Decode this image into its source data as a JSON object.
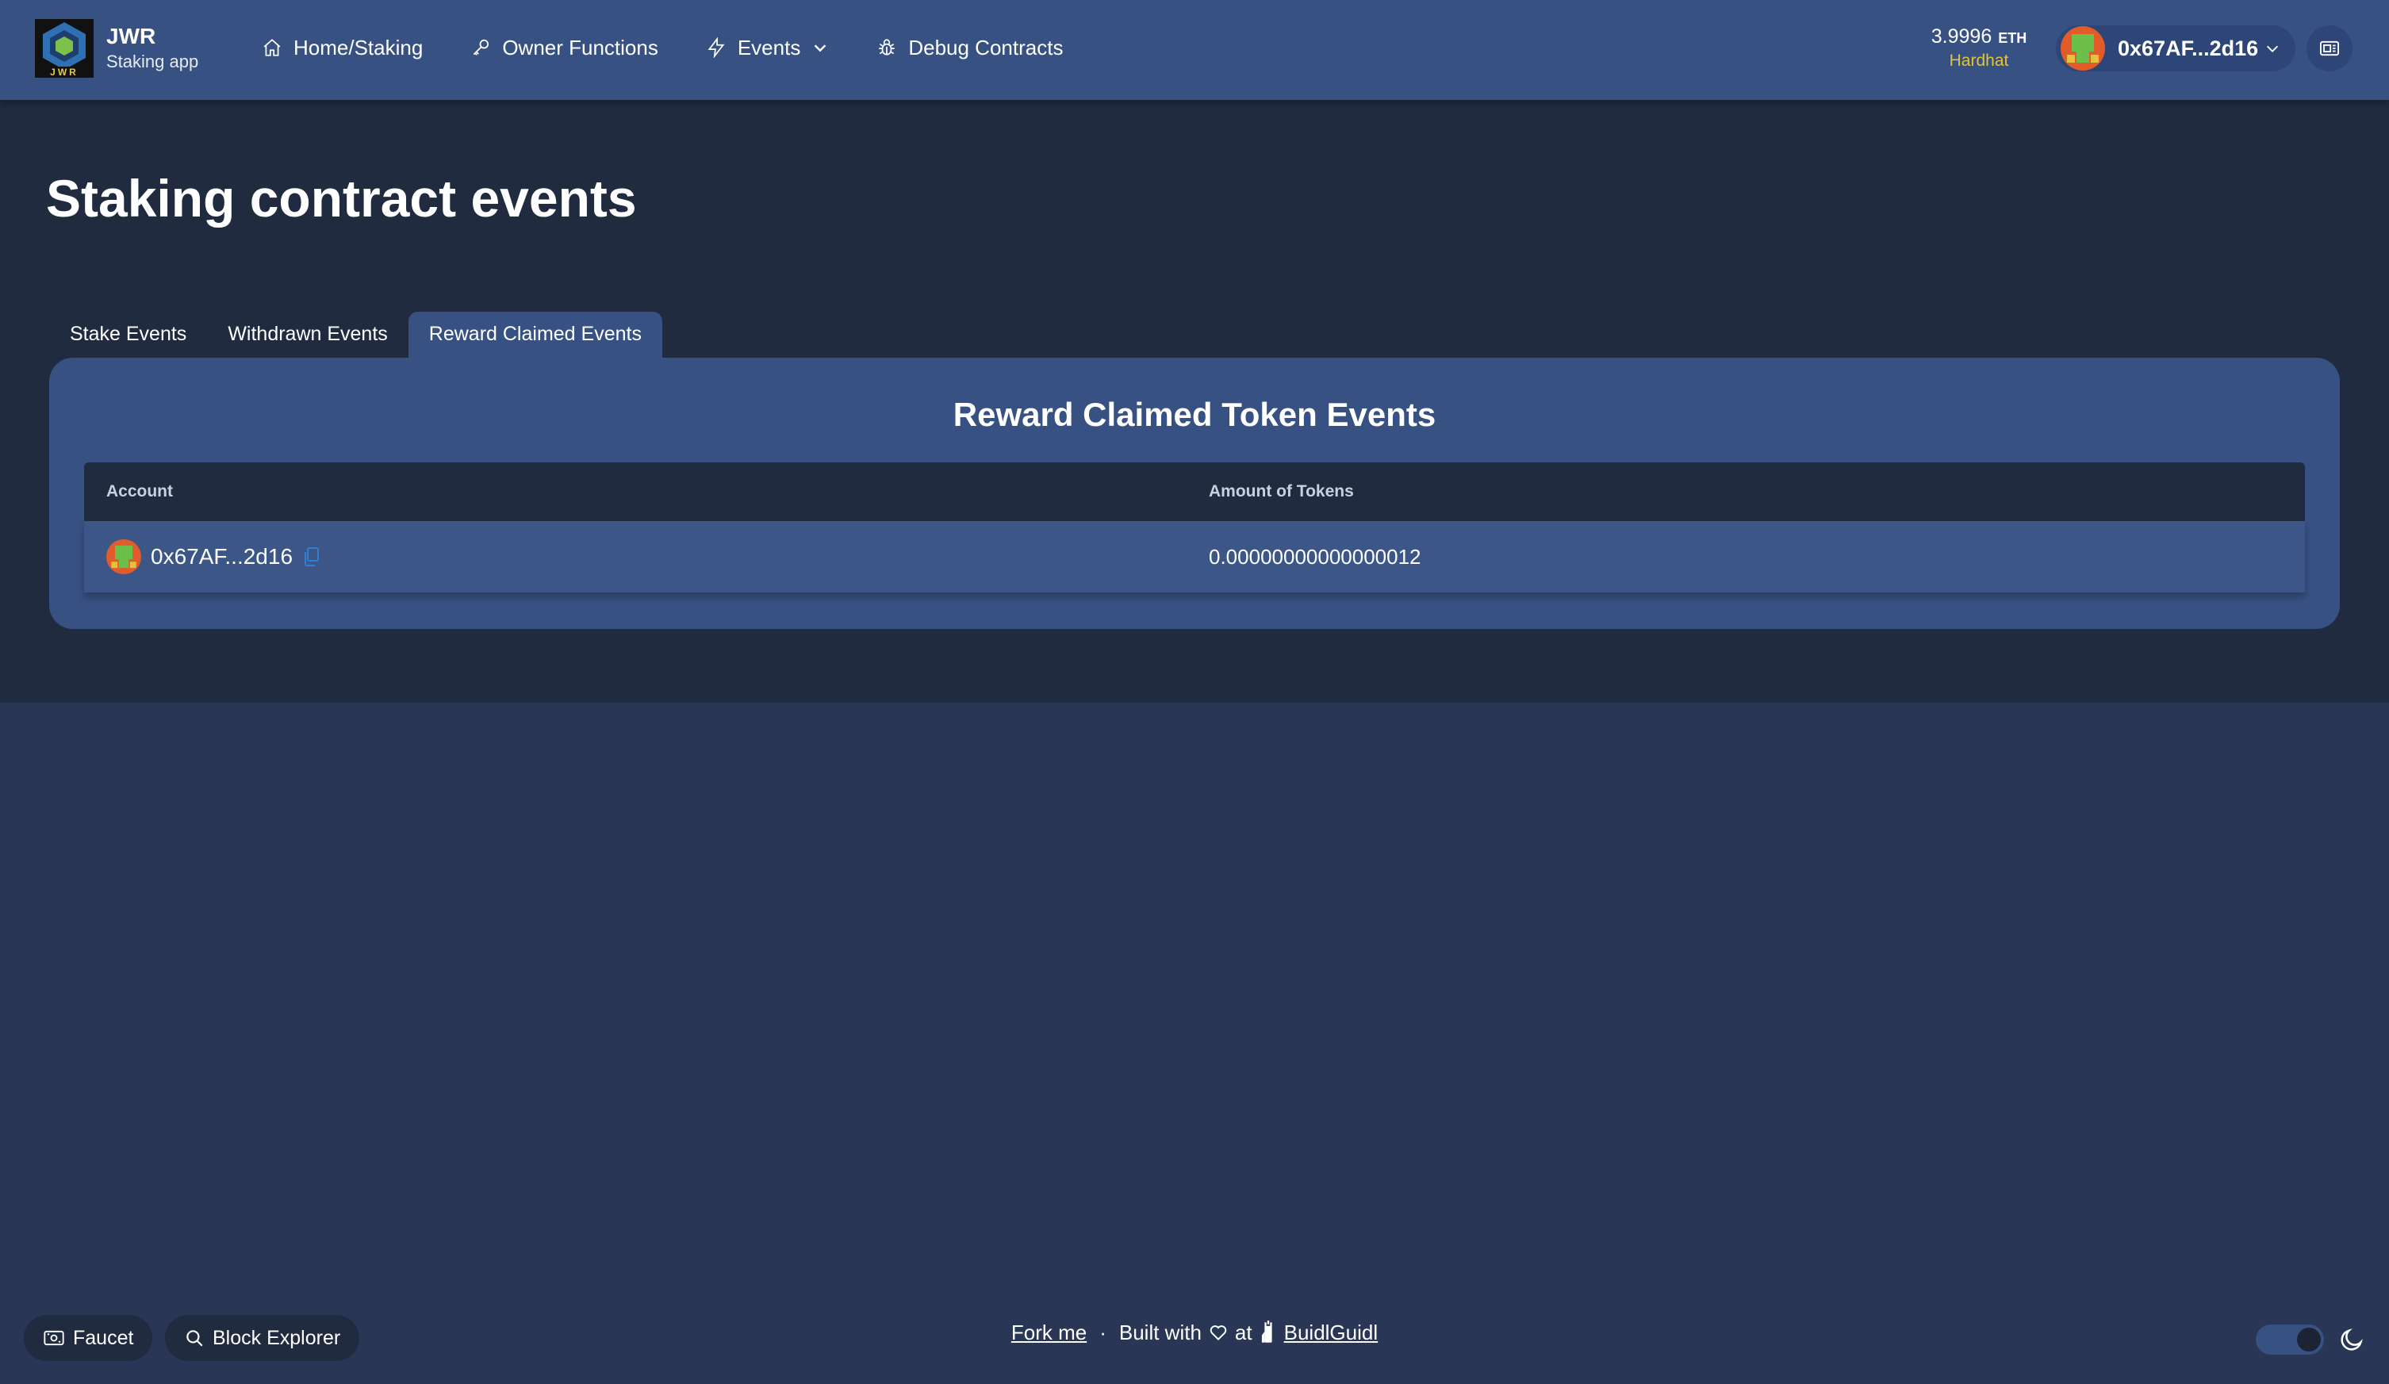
{
  "app": {
    "title": "JWR",
    "subtitle": "Staking app",
    "logo_text": "JWR"
  },
  "nav": {
    "items": [
      {
        "label": "Home/Staking",
        "icon": "home-icon"
      },
      {
        "label": "Owner Functions",
        "icon": "key-icon"
      },
      {
        "label": "Events",
        "icon": "bolt-icon",
        "dropdown": true
      },
      {
        "label": "Debug Contracts",
        "icon": "bug-icon"
      }
    ]
  },
  "wallet": {
    "balance": "3.9996",
    "unit": "ETH",
    "network": "Hardhat",
    "address": "0x67AF...2d16"
  },
  "page": {
    "title": "Staking contract events",
    "tabs": [
      {
        "label": "Stake Events",
        "active": false
      },
      {
        "label": "Withdrawn Events",
        "active": false
      },
      {
        "label": "Reward Claimed Events",
        "active": true
      }
    ],
    "panel_title": "Reward Claimed Token Events",
    "table": {
      "columns": [
        "Account",
        "Amount of Tokens"
      ],
      "rows": [
        {
          "account": "0x67AF...2d16",
          "amount": "0.00000000000000012"
        }
      ]
    }
  },
  "footer": {
    "faucet_label": "Faucet",
    "explorer_label": "Block Explorer",
    "fork_label": "Fork me",
    "separator": "·",
    "built_with": "Built with",
    "at": "at",
    "buidl_label": "BuidlGuidl"
  },
  "colors": {
    "header_bg": "#385183",
    "page_bg": "#212b40",
    "body_bg": "#2a3655",
    "network": "#e2c33c",
    "copy_icon": "#2f7fd6"
  }
}
